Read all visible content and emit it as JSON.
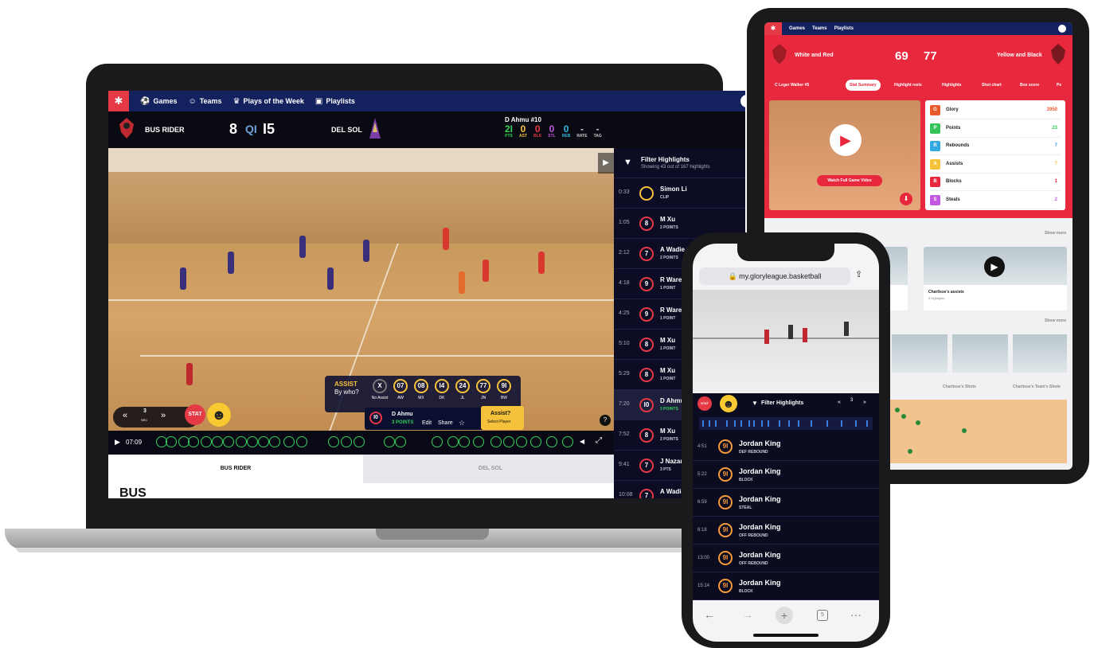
{
  "laptop": {
    "nav": {
      "items": [
        {
          "label": "Games",
          "icon": "basketball-icon"
        },
        {
          "label": "Teams",
          "icon": "people-icon"
        },
        {
          "label": "Plays of the Week",
          "icon": "trophy-icon"
        },
        {
          "label": "Playlists",
          "icon": "playlist-icon"
        }
      ]
    },
    "scoreboard": {
      "team1": "BUS RIDER",
      "score1": "8",
      "quarter": "QI",
      "score2": "I5",
      "team2": "DEL SOL"
    },
    "player": {
      "name": "D Ahmu #10",
      "stats": [
        {
          "value": "2I",
          "label": "PTS",
          "color": "#34d058"
        },
        {
          "value": "0",
          "label": "AST",
          "color": "#f7c23b"
        },
        {
          "value": "0",
          "label": "BLK",
          "color": "#e53945"
        },
        {
          "value": "0",
          "label": "STL",
          "color": "#c258e0"
        },
        {
          "value": "0",
          "label": "REB",
          "color": "#34b8e0"
        },
        {
          "value": "-",
          "label": "RATE",
          "color": "#cccccc"
        },
        {
          "value": "-",
          "label": "TAG",
          "color": "#cccccc"
        }
      ]
    },
    "assist": {
      "title": "ASSIST",
      "subtitle": "By who?",
      "options": [
        {
          "num": "X",
          "label": "No Assist"
        },
        {
          "num": "07",
          "label": "AW"
        },
        {
          "num": "08",
          "label": "MX"
        },
        {
          "num": "I4",
          "label": "DK"
        },
        {
          "num": "24",
          "label": "JL"
        },
        {
          "num": "77",
          "label": "JN"
        },
        {
          "num": "9I",
          "label": "BW"
        }
      ]
    },
    "clip": {
      "badge": "I0",
      "name": "D Ahmu",
      "type": "3 POINTS",
      "edit": "Edit",
      "share": "Share"
    },
    "assist_prompt": {
      "title": "Assist?",
      "sub": "Select Player"
    },
    "controls": {
      "rewind": "«",
      "speed": "3",
      "speed_unit": "SEC",
      "forward": "»",
      "stat": "STAT",
      "help": "?"
    },
    "timeline": {
      "time": "07:09"
    },
    "tabs": {
      "tab1": "BUS RIDER",
      "tab2": "DEL SOL"
    },
    "below_title": "BUS",
    "sidebar": {
      "title": "Filter Highlights",
      "subtitle": "Showing 43 out of 167 highlights",
      "rows": [
        {
          "time": "0:33",
          "badge": "",
          "name": "Simon Li",
          "type": "CLIP"
        },
        {
          "time": "1:05",
          "badge": "8",
          "name": "M Xu",
          "type": "2 POINTS"
        },
        {
          "time": "2:12",
          "badge": "7",
          "name": "A Wadie",
          "type": "2 POINTS"
        },
        {
          "time": "4:18",
          "badge": "9",
          "name": "R Wareing",
          "type": "1 POINT"
        },
        {
          "time": "4:25",
          "badge": "9",
          "name": "R Wareing",
          "type": "1 POINT"
        },
        {
          "time": "5:10",
          "badge": "8",
          "name": "M Xu",
          "type": "1 POINT"
        },
        {
          "time": "5:29",
          "badge": "8",
          "name": "M Xu",
          "type": "1 POINT"
        },
        {
          "time": "7:20",
          "badge": "I0",
          "name": "D Ahmu",
          "type": "3 POINTS"
        },
        {
          "time": "7:52",
          "badge": "8",
          "name": "M Xu",
          "type": "2 POINTS"
        },
        {
          "time": "9:41",
          "badge": "7",
          "name": "J Nazar",
          "type": "3 PTS"
        },
        {
          "time": "10:08",
          "badge": "7",
          "name": "A Wadie",
          "type": ""
        }
      ]
    }
  },
  "tablet": {
    "nav": {
      "items": [
        "Games",
        "Teams",
        "Playlists"
      ]
    },
    "header": {
      "team1": "White and Red",
      "score1": "69",
      "score2": "77",
      "team2": "Yellow and Black"
    },
    "tabs": [
      "C Leger Walker #5",
      "Stat Summary",
      "Highlight reels",
      "Highlights",
      "Shot chart",
      "Box score",
      "Pe"
    ],
    "watch_label": "Watch Full Game Video",
    "stats": [
      {
        "letter": "G",
        "label": "Glory",
        "value": "3950",
        "color": "#e85a2a"
      },
      {
        "letter": "P",
        "label": "Points",
        "value": "23",
        "color": "#34c45a"
      },
      {
        "letter": "R",
        "label": "Rebounds",
        "value": "7",
        "color": "#34a8e0"
      },
      {
        "letter": "A",
        "label": "Assists",
        "value": "7",
        "color": "#f7c23b"
      },
      {
        "letter": "B",
        "label": "Blocks",
        "value": "1",
        "color": "#e8283d"
      },
      {
        "letter": "S",
        "label": "Steals",
        "value": "2",
        "color": "#c258e0"
      }
    ],
    "show_more": "Show more",
    "card": {
      "caption": "Charlisse's assists",
      "count": "8 highlights"
    },
    "shots_tabs": [
      "Charlisse's Shots",
      "Charlisse's Team's Shots"
    ]
  },
  "phone": {
    "url": "my.gloryleague.basketball",
    "controls": {
      "stat": "STAT",
      "filter": "Filter Highlights",
      "rewind": "«",
      "speed": "3",
      "forward": "»"
    },
    "rows": [
      {
        "time": "4:51",
        "badge": "9I",
        "name": "Jordan King",
        "type": "DEF REBOUND"
      },
      {
        "time": "5:22",
        "badge": "9I",
        "name": "Jordan King",
        "type": "BLOCK"
      },
      {
        "time": "6:59",
        "badge": "9I",
        "name": "Jordan King",
        "type": "STEAL"
      },
      {
        "time": "8:18",
        "badge": "9I",
        "name": "Jordan King",
        "type": "OFF REBOUND"
      },
      {
        "time": "13:00",
        "badge": "9I",
        "name": "Jordan King",
        "type": "OFF REBOUND"
      },
      {
        "time": "15:14",
        "badge": "9I",
        "name": "Jordan King",
        "type": "BLOCK"
      }
    ],
    "tab_count": "5"
  }
}
